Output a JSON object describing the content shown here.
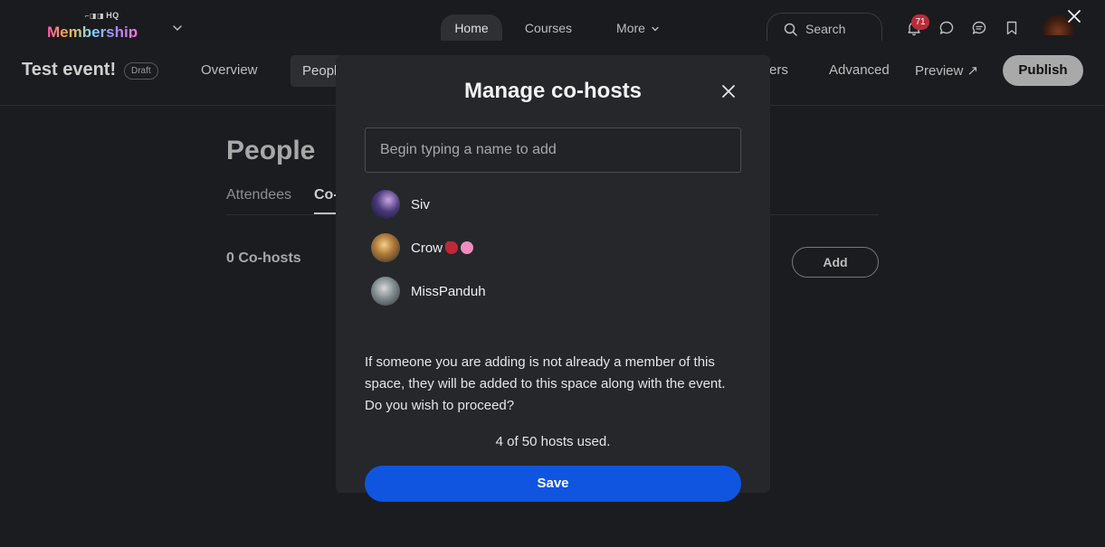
{
  "topbar": {
    "logo_top": "HQ",
    "logo_word": "Membership",
    "tabs": [
      {
        "label": "Home",
        "active": true
      },
      {
        "label": "Courses",
        "active": false
      },
      {
        "label": "More",
        "active": false
      }
    ],
    "search_label": "Search",
    "notification_count": "71"
  },
  "event_bar": {
    "title": "Test event!",
    "status_badge": "Draft",
    "tabs": [
      {
        "label": "Overview"
      },
      {
        "label": "People",
        "active": true
      },
      {
        "label": "ers"
      },
      {
        "label": "Advanced"
      },
      {
        "label": "Preview ↗"
      }
    ],
    "publish_label": "Publish"
  },
  "page": {
    "title": "People",
    "tabs": [
      {
        "label": "Attendees"
      },
      {
        "label": "Co-",
        "active": true
      }
    ],
    "cohost_count": "0 Co-hosts",
    "add_label": "Add"
  },
  "modal": {
    "title": "Manage co-hosts",
    "input_placeholder": "Begin typing a name to add",
    "suggestions": [
      {
        "name": "Siv"
      },
      {
        "name": "Crow"
      },
      {
        "name": "MissPanduh"
      }
    ],
    "warning": "If someone you are adding is not already a member of this space, they will be added to this space along with the event. Do you wish to proceed?",
    "hosts_used": "4 of 50 hosts used.",
    "save_label": "Save"
  },
  "colors": {
    "background": "#1b1c1f",
    "modal_bg": "#25272b",
    "primary_button": "#0f55e0",
    "badge": "#b92b3a"
  }
}
